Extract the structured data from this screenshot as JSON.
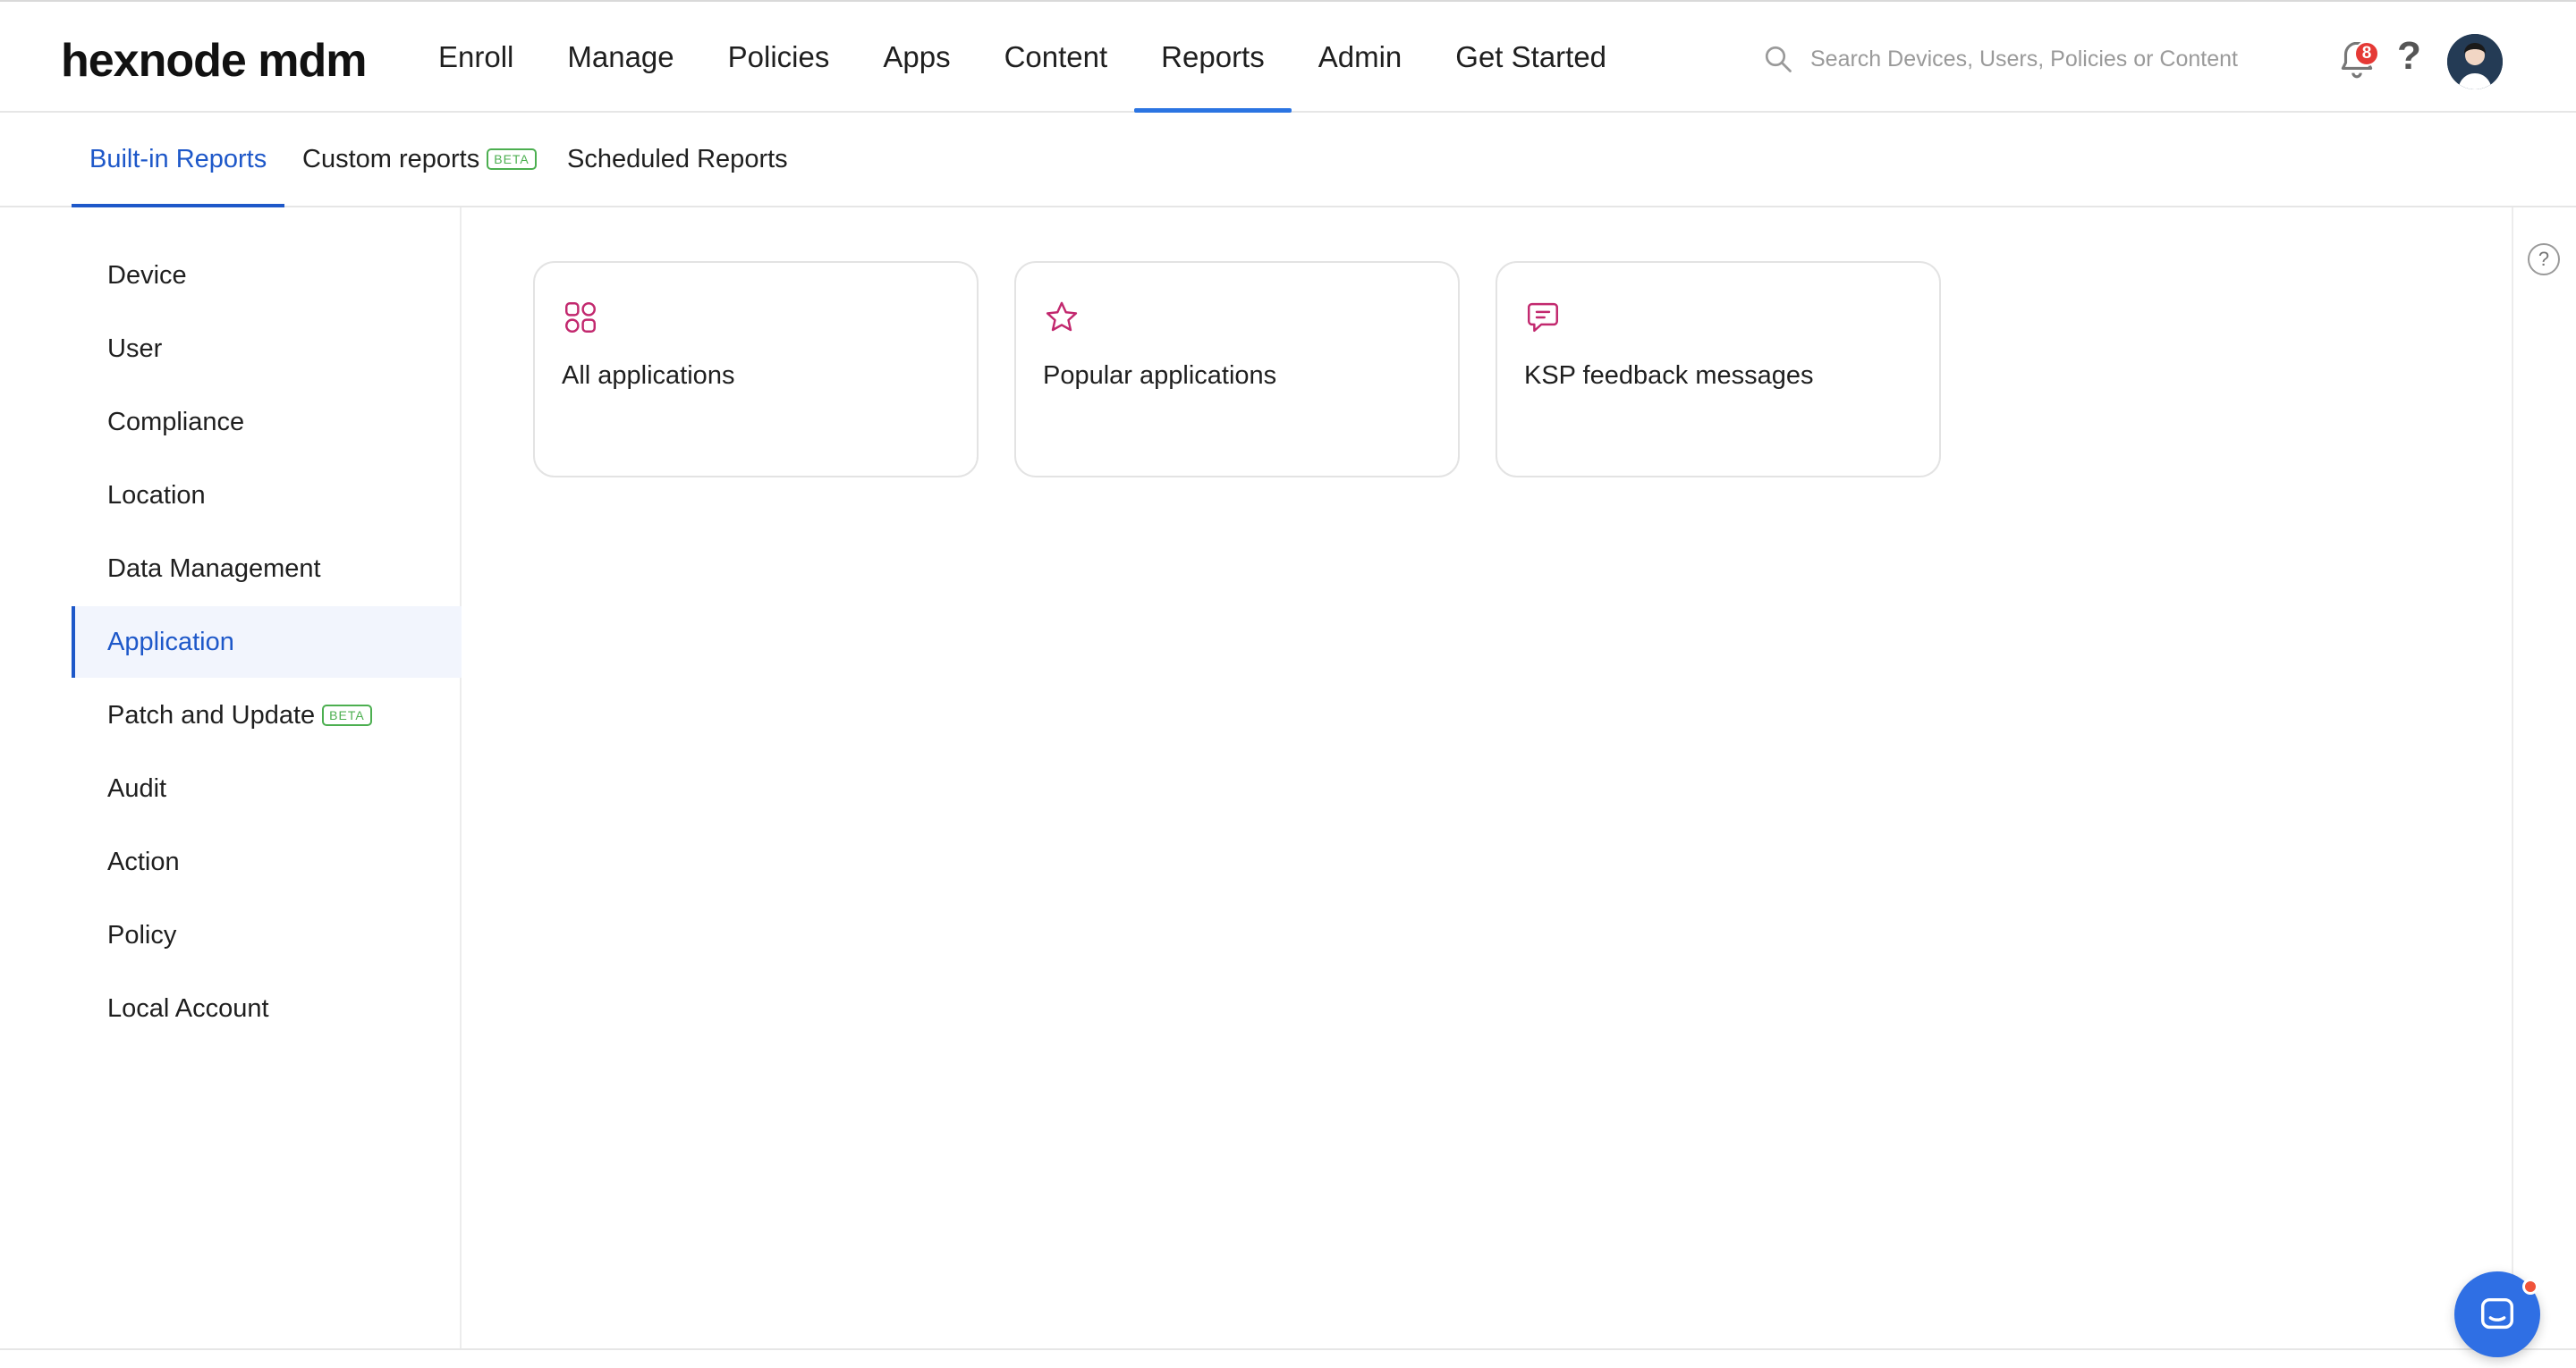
{
  "app": {
    "logo": "hexnode mdm",
    "nav": [
      "Enroll",
      "Manage",
      "Policies",
      "Apps",
      "Content",
      "Reports",
      "Admin",
      "Get Started"
    ],
    "active_nav": "Reports",
    "search_placeholder": "Search Devices, Users, Policies or Content",
    "notification_count": "8",
    "help_glyph": "?"
  },
  "subtabs": {
    "built_in": "Built-in Reports",
    "custom": "Custom reports",
    "custom_badge": "BETA",
    "scheduled": "Scheduled Reports"
  },
  "sidebar": {
    "items": [
      {
        "label": "Device"
      },
      {
        "label": "User"
      },
      {
        "label": "Compliance"
      },
      {
        "label": "Location"
      },
      {
        "label": "Data Management"
      },
      {
        "label": "Application"
      },
      {
        "label": "Patch and Update",
        "badge": "BETA"
      },
      {
        "label": "Audit"
      },
      {
        "label": "Action"
      },
      {
        "label": "Policy"
      },
      {
        "label": "Local Account"
      }
    ],
    "active": "Application"
  },
  "cards": [
    {
      "label": "All applications",
      "icon": "apps-grid-icon"
    },
    {
      "label": "Popular applications",
      "icon": "star-icon"
    },
    {
      "label": "KSP feedback messages",
      "icon": "message-icon"
    }
  ],
  "colors": {
    "accent": "#1e58c9",
    "nav_underline": "#2b74e2",
    "card_icon": "#c2286e",
    "beta_green": "#4caf50"
  }
}
